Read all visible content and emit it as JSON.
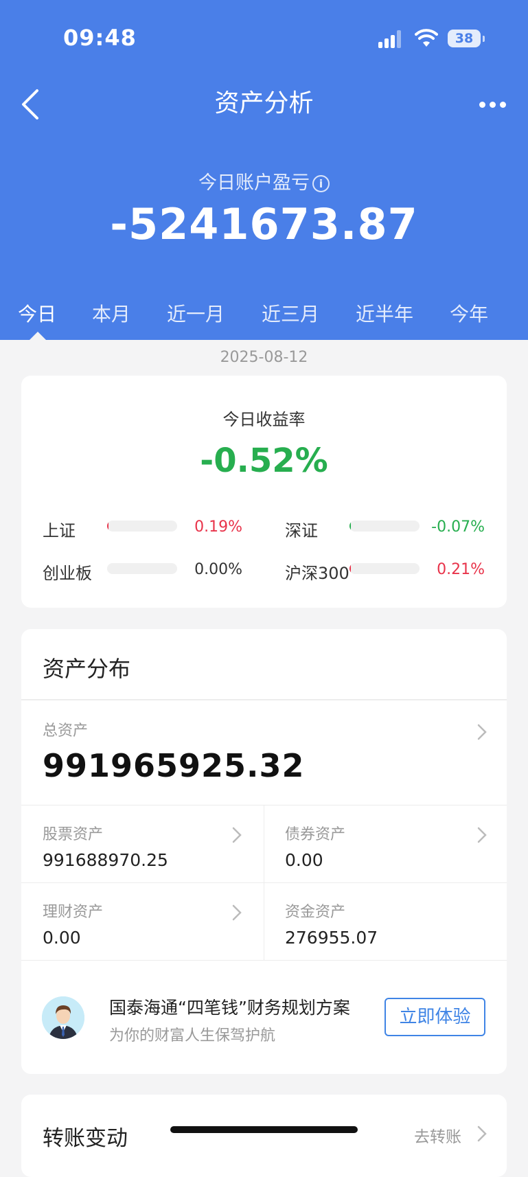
{
  "status_bar": {
    "time": "09:48",
    "battery": "38"
  },
  "nav": {
    "title": "资产分析"
  },
  "summary": {
    "pl_label": "今日账户盈亏",
    "pl_value": "-5241673.87"
  },
  "tabs": [
    {
      "label": "今日"
    },
    {
      "label": "本月"
    },
    {
      "label": "近一月"
    },
    {
      "label": "近三月"
    },
    {
      "label": "近半年"
    },
    {
      "label": "今年"
    }
  ],
  "date": "2025-08-12",
  "returns": {
    "label": "今日收益率",
    "value": "-0.52%",
    "indices": [
      {
        "name": "上证",
        "value": "0.19%",
        "color": "#e8334a",
        "fill": 0.02
      },
      {
        "name": "深证",
        "value": "-0.07%",
        "color": "#27ae4f",
        "fill": 0.01
      },
      {
        "name": "创业板",
        "value": "0.00%",
        "color": "#333333",
        "fill": 0.0
      },
      {
        "name": "沪深300",
        "value": "0.21%",
        "color": "#e8334a",
        "fill": 0.02
      }
    ]
  },
  "distribution": {
    "title": "资产分布",
    "total_label": "总资产",
    "total_value": "991965925.32",
    "cells": [
      {
        "label": "股票资产",
        "value": "991688970.25"
      },
      {
        "label": "债券资产",
        "value": "0.00"
      },
      {
        "label": "理财资产",
        "value": "0.00"
      },
      {
        "label": "资金资产",
        "value": "276955.07"
      }
    ],
    "promo": {
      "title": "国泰海通“四笔钱”财务规划方案",
      "subtitle": "为你的财富人生保驾护航",
      "button": "立即体验"
    }
  },
  "transfer": {
    "title": "转账变动",
    "link": "去转账"
  },
  "colors": {
    "header": "#4a7fe8",
    "up": "#e8334a",
    "down": "#27ae4f",
    "accent": "#3f84e5"
  }
}
